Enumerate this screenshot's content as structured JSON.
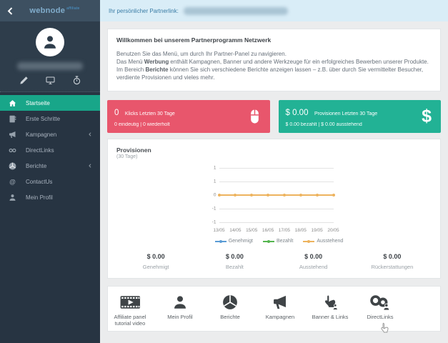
{
  "sidebar": {
    "logo": "webnode",
    "logo_suffix": "affiliate",
    "menu": [
      {
        "label": "Startseite",
        "icon": "home-icon",
        "active": true,
        "chevron": false
      },
      {
        "label": "Erste Schritte",
        "icon": "book-icon",
        "active": false,
        "chevron": false
      },
      {
        "label": "Kampagnen",
        "icon": "megaphone-icon",
        "active": false,
        "chevron": true
      },
      {
        "label": "DirectLinks",
        "icon": "link-icon",
        "active": false,
        "chevron": false
      },
      {
        "label": "Berichte",
        "icon": "pie-chart-icon",
        "active": false,
        "chevron": true
      },
      {
        "label": "ContactUs",
        "icon": "at-icon",
        "active": false,
        "chevron": false
      },
      {
        "label": "Mein Profil",
        "icon": "user-icon",
        "active": false,
        "chevron": false
      }
    ]
  },
  "topbar": {
    "label": "Ihr persönlicher Partnerlink:"
  },
  "welcome": {
    "title": "Willkommen bei unserem Partnerprogramm Netzwerk",
    "line1": "Benutzen Sie das Menü, um durch Ihr Partner-Panel zu navigieren.",
    "line2_pre": "Das Menü ",
    "line2_bold": "Werbung",
    "line2_post": " enthält Kampagnen, Banner und andere Werkzeuge für ein erfolgreiches Bewerben unserer Produkte.",
    "line3_pre": "Im Bereich ",
    "line3_bold": "Berichte",
    "line3_post": " können Sie sich verschiedene Berichte anzeigen lassen – z.B. über durch Sie vermittelter Besucher, verdiente Provisionen und vieles mehr."
  },
  "stats": {
    "clicks": {
      "value": "0",
      "label": "Klicks Letzten 30 Tage",
      "detail": "0 eindeutig | 0 wiederholt",
      "color": "#e8566c"
    },
    "commissions": {
      "value": "$ 0.00",
      "label": "Provisionen Letzten 30 Tage",
      "detail": "$ 0.00 bezahlt | $ 0.00 ausstehend",
      "color": "#22b295",
      "icon_char": "$"
    }
  },
  "chart_data": {
    "type": "line",
    "title": "Provisionen",
    "subtitle": "(30 Tage)",
    "x": [
      "13/05",
      "14/05",
      "15/05",
      "16/05",
      "17/05",
      "18/05",
      "19/05",
      "20/05"
    ],
    "series": [
      {
        "name": "Genehmigt",
        "color": "#5b9cd5",
        "values": [
          0,
          0,
          0,
          0,
          0,
          0,
          0,
          0
        ]
      },
      {
        "name": "Bezahlt",
        "color": "#55b54f",
        "values": [
          0,
          0,
          0,
          0,
          0,
          0,
          0,
          0
        ]
      },
      {
        "name": "Ausstehend",
        "color": "#edb35e",
        "values": [
          0,
          0,
          0,
          0,
          0,
          0,
          0,
          0
        ]
      }
    ],
    "y_tick_labels": [
      "1",
      "1",
      "0",
      "-1",
      "-1"
    ],
    "ylim": [
      -1,
      1
    ],
    "grid": true,
    "legend_position": "bottom"
  },
  "summary": [
    {
      "value": "$ 0.00",
      "label": "Genehmigt"
    },
    {
      "value": "$ 0.00",
      "label": "Bezahlt"
    },
    {
      "value": "$ 0.00",
      "label": "Ausstehend"
    },
    {
      "value": "$ 0.00",
      "label": "Rückerstattungen"
    }
  ],
  "shortcuts": [
    {
      "label": "Affiliate panel tutorial video",
      "icon": "film-icon",
      "cursor": false
    },
    {
      "label": "Mein Profil",
      "icon": "user-icon",
      "cursor": false
    },
    {
      "label": "Berichte",
      "icon": "pie-chart-icon",
      "cursor": false
    },
    {
      "label": "Kampagnen",
      "icon": "megaphone-icon",
      "cursor": false
    },
    {
      "label": "Banner & Links",
      "icon": "banner-pointer-icon",
      "cursor": false
    },
    {
      "label": "DirectLinks",
      "icon": "links-icon",
      "cursor": true
    }
  ]
}
